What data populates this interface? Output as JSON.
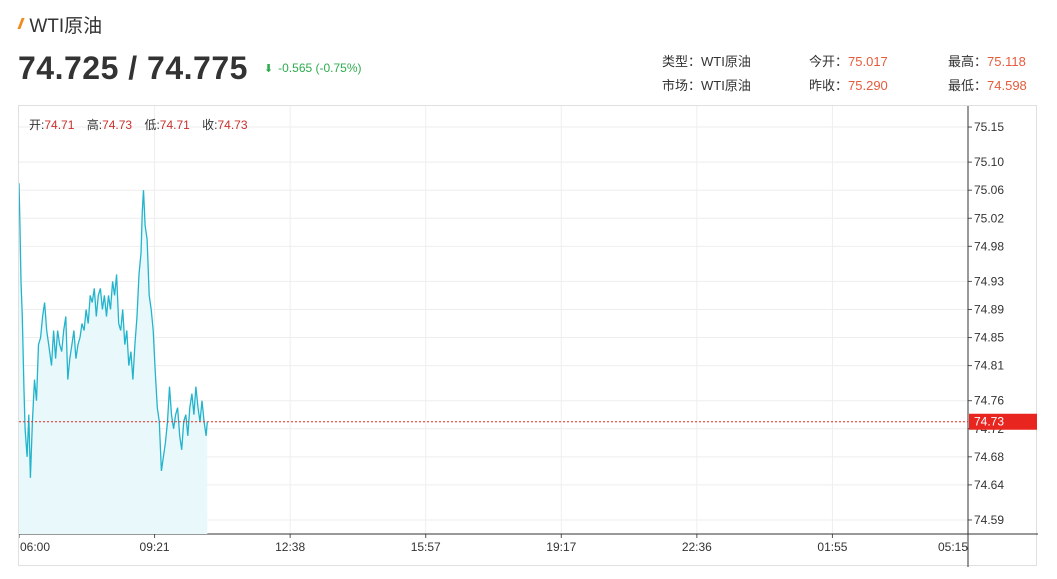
{
  "header": {
    "icon": "double-slash-icon",
    "title": "WTI原油",
    "price_text": "74.725 / 74.775",
    "change_text": "-0.565 (-0.75%)",
    "change_icon": "arrow-down-icon",
    "change_color": "#2eab4e"
  },
  "info": {
    "type_label": "类型：",
    "type_value": "WTI原油",
    "market_label": "市场：",
    "market_value": "WTI原油",
    "open_label": "今开：",
    "open_value": "75.017",
    "prev_close_label": "昨收：",
    "prev_close_value": "75.290",
    "high_label": "最高：",
    "high_value": "75.118",
    "low_label": "最低：",
    "low_value": "74.598",
    "value_color": "#e55c3c"
  },
  "ohlc": {
    "open_label": "开:",
    "open_value": "74.71",
    "high_label": "高:",
    "high_value": "74.73",
    "low_label": "低:",
    "low_value": "74.71",
    "close_label": "收:",
    "close_value": "74.73"
  },
  "chart_data": {
    "type": "area",
    "title": "",
    "xlabel": "",
    "ylabel": "",
    "x_ticks": [
      "06:00",
      "09:21",
      "12:38",
      "15:57",
      "19:17",
      "22:36",
      "01:55",
      "05:15"
    ],
    "y_ticks": [
      "75.15",
      "75.10",
      "75.06",
      "75.02",
      "74.98",
      "74.93",
      "74.89",
      "74.85",
      "74.81",
      "74.76",
      "74.72",
      "74.68",
      "74.64",
      "74.59"
    ],
    "ylim": [
      74.57,
      75.18
    ],
    "current_price": 74.73,
    "current_price_label": "74.73",
    "line_color": "#22b4cc",
    "fill_color": "#e9f8fb",
    "marker_color": "#e8261f",
    "grid": true,
    "points": [
      [
        0,
        75.07
      ],
      [
        0.02,
        75.02
      ],
      [
        0.05,
        74.93
      ],
      [
        0.08,
        74.88
      ],
      [
        0.12,
        74.78
      ],
      [
        0.15,
        74.72
      ],
      [
        0.2,
        74.68
      ],
      [
        0.24,
        74.74
      ],
      [
        0.28,
        74.65
      ],
      [
        0.33,
        74.73
      ],
      [
        0.38,
        74.79
      ],
      [
        0.43,
        74.76
      ],
      [
        0.48,
        74.84
      ],
      [
        0.53,
        74.85
      ],
      [
        0.58,
        74.88
      ],
      [
        0.63,
        74.9
      ],
      [
        0.68,
        74.86
      ],
      [
        0.73,
        74.84
      ],
      [
        0.8,
        74.81
      ],
      [
        0.85,
        74.86
      ],
      [
        0.9,
        74.82
      ],
      [
        0.95,
        74.86
      ],
      [
        1.0,
        74.84
      ],
      [
        1.05,
        74.83
      ],
      [
        1.1,
        74.86
      ],
      [
        1.15,
        74.88
      ],
      [
        1.2,
        74.79
      ],
      [
        1.25,
        74.82
      ],
      [
        1.3,
        74.84
      ],
      [
        1.35,
        74.86
      ],
      [
        1.4,
        74.82
      ],
      [
        1.45,
        74.84
      ],
      [
        1.5,
        74.85
      ],
      [
        1.55,
        74.87
      ],
      [
        1.6,
        74.86
      ],
      [
        1.65,
        74.89
      ],
      [
        1.7,
        74.87
      ],
      [
        1.75,
        74.91
      ],
      [
        1.8,
        74.9
      ],
      [
        1.85,
        74.92
      ],
      [
        1.9,
        74.88
      ],
      [
        1.95,
        74.91
      ],
      [
        2.0,
        74.92
      ],
      [
        2.05,
        74.89
      ],
      [
        2.1,
        74.91
      ],
      [
        2.15,
        74.88
      ],
      [
        2.2,
        74.91
      ],
      [
        2.25,
        74.89
      ],
      [
        2.3,
        74.93
      ],
      [
        2.35,
        74.91
      ],
      [
        2.4,
        74.94
      ],
      [
        2.45,
        74.87
      ],
      [
        2.5,
        74.86
      ],
      [
        2.55,
        74.89
      ],
      [
        2.6,
        74.84
      ],
      [
        2.65,
        74.86
      ],
      [
        2.7,
        74.81
      ],
      [
        2.75,
        74.83
      ],
      [
        2.8,
        74.79
      ],
      [
        2.85,
        74.84
      ],
      [
        2.9,
        74.88
      ],
      [
        2.95,
        74.94
      ],
      [
        3.0,
        74.97
      ],
      [
        3.03,
        75.03
      ],
      [
        3.06,
        75.06
      ],
      [
        3.1,
        75.01
      ],
      [
        3.15,
        74.99
      ],
      [
        3.2,
        74.91
      ],
      [
        3.25,
        74.89
      ],
      [
        3.3,
        74.86
      ],
      [
        3.35,
        74.8
      ],
      [
        3.4,
        74.75
      ],
      [
        3.45,
        74.73
      ],
      [
        3.5,
        74.66
      ],
      [
        3.55,
        74.68
      ],
      [
        3.6,
        74.7
      ],
      [
        3.65,
        74.73
      ],
      [
        3.7,
        74.78
      ],
      [
        3.75,
        74.74
      ],
      [
        3.8,
        74.72
      ],
      [
        3.85,
        74.74
      ],
      [
        3.9,
        74.75
      ],
      [
        3.95,
        74.71
      ],
      [
        4.0,
        74.69
      ],
      [
        4.05,
        74.73
      ],
      [
        4.1,
        74.74
      ],
      [
        4.15,
        74.71
      ],
      [
        4.2,
        74.75
      ],
      [
        4.25,
        74.77
      ],
      [
        4.3,
        74.74
      ],
      [
        4.35,
        74.78
      ],
      [
        4.4,
        74.75
      ],
      [
        4.45,
        74.73
      ],
      [
        4.5,
        74.76
      ],
      [
        4.55,
        74.73
      ],
      [
        4.6,
        74.71
      ],
      [
        4.63,
        74.73
      ]
    ],
    "x_units": "hours since 06:00"
  }
}
